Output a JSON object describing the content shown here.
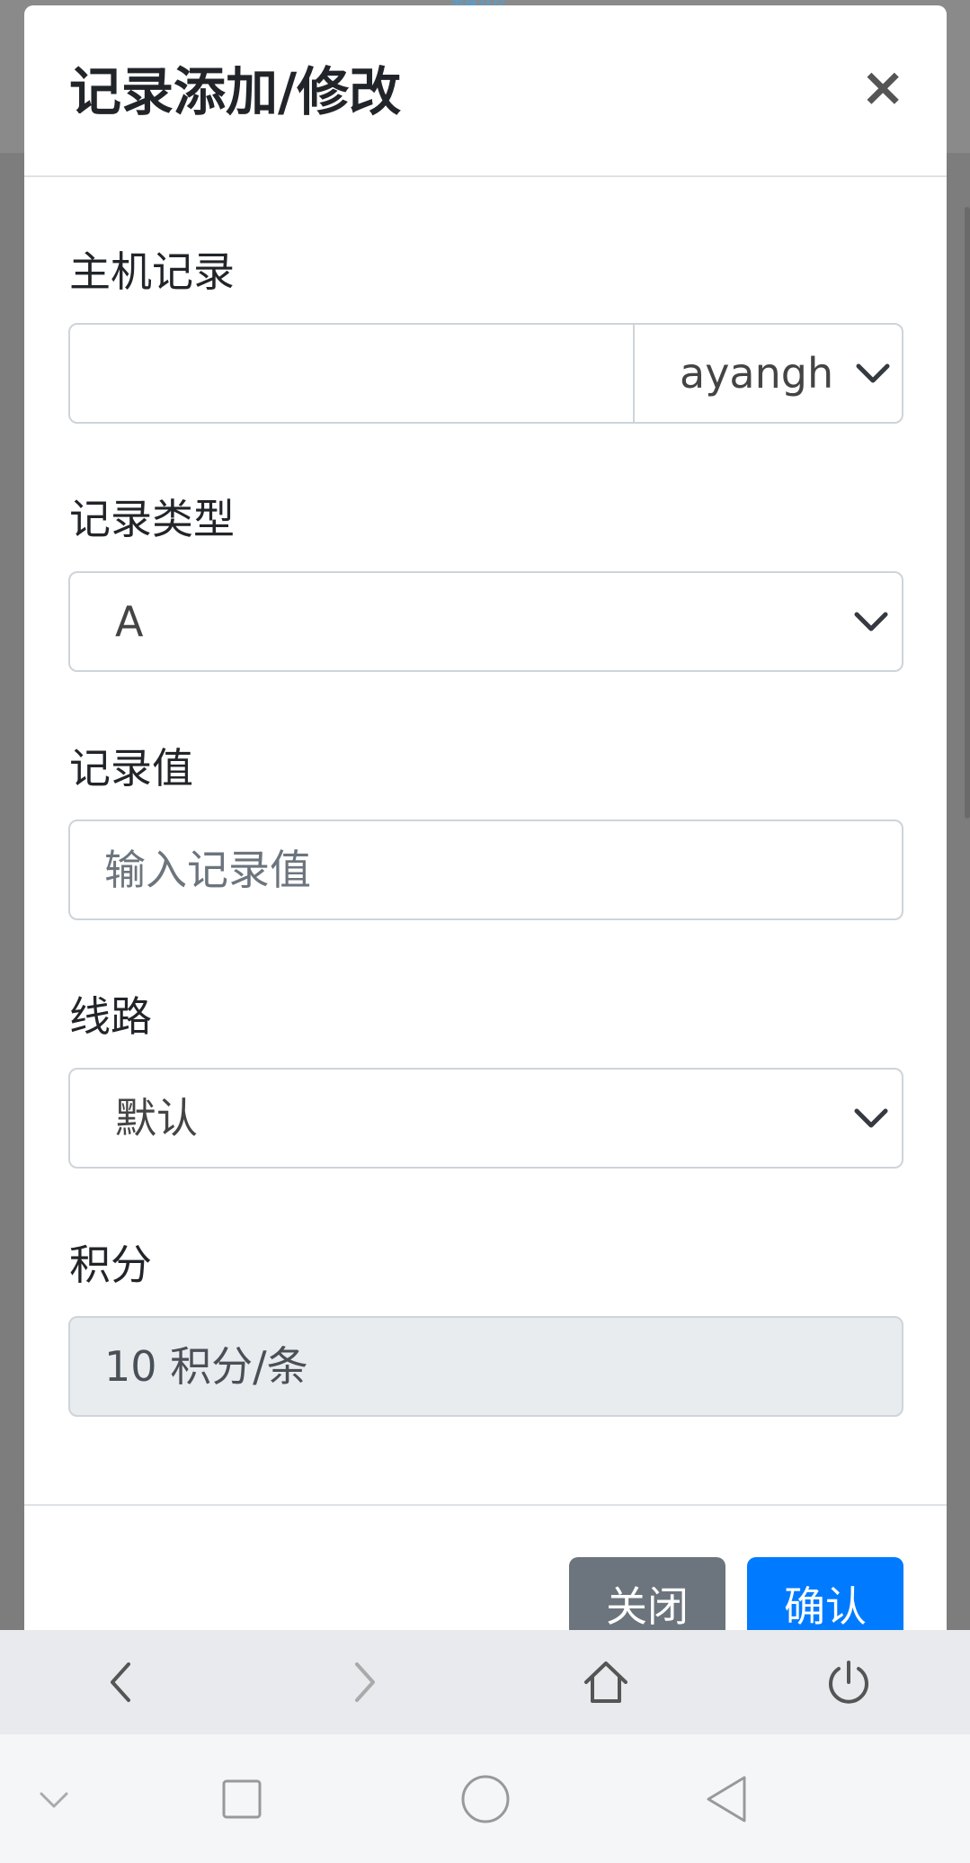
{
  "backdrop": {
    "top_text": "流量社区"
  },
  "modal": {
    "title": "记录添加/修改",
    "close_icon": "×",
    "fields": {
      "host": {
        "label": "主机记录",
        "value": "",
        "domain": "ayangh"
      },
      "type": {
        "label": "记录类型",
        "value": "A"
      },
      "value": {
        "label": "记录值",
        "placeholder": "输入记录值"
      },
      "line": {
        "label": "线路",
        "value": "默认"
      },
      "points": {
        "label": "积分",
        "value": "10 积分/条"
      }
    },
    "footer": {
      "close_label": "关闭",
      "confirm_label": "确认"
    }
  },
  "colors": {
    "primary": "#007bff",
    "secondary": "#6c757d"
  },
  "browser_bar": {
    "icons": [
      "back-icon",
      "forward-icon",
      "home-icon",
      "power-icon"
    ]
  },
  "system_bar": {
    "icons": [
      "chevron-down-icon",
      "recent-apps-icon",
      "home-circle-icon",
      "back-triangle-icon"
    ]
  }
}
